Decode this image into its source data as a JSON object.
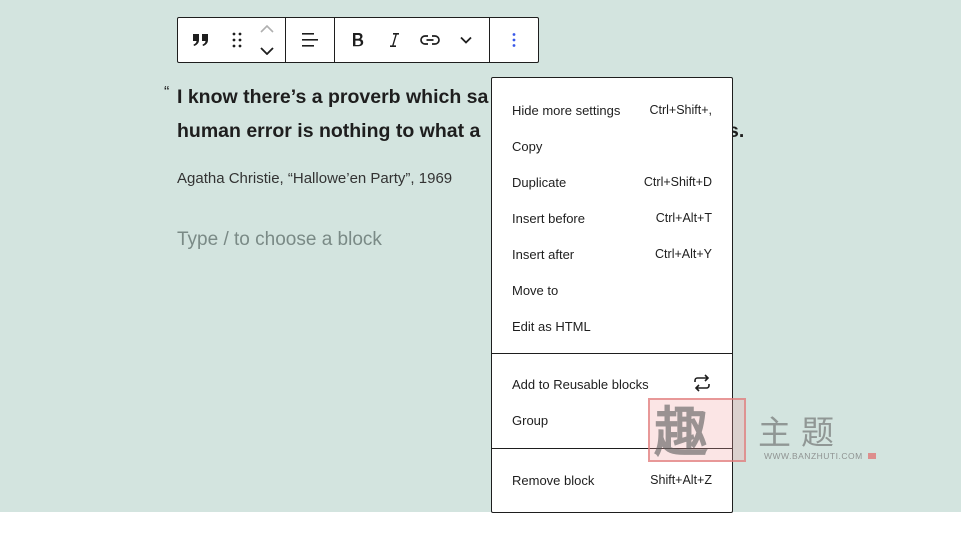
{
  "toolbar": {
    "items": [
      {
        "name": "quote-block-icon"
      },
      {
        "name": "drag-handle-icon"
      },
      {
        "name": "move-up-icon"
      },
      {
        "name": "move-down-icon"
      },
      {
        "name": "align-icon"
      },
      {
        "name": "bold-icon"
      },
      {
        "name": "italic-icon"
      },
      {
        "name": "link-icon"
      },
      {
        "name": "chevron-down-icon"
      },
      {
        "name": "more-options-icon"
      }
    ]
  },
  "quote": {
    "mark": "“",
    "line1": "I know there’s a proverb which sa",
    "line2": "human error is nothing to what a",
    "line2_tail": "s.",
    "citation": "Agatha Christie, “Hallowe’en Party”, 1969"
  },
  "placeholder": "Type / to choose a block",
  "menu": {
    "section1": [
      {
        "label": "Hide more settings",
        "shortcut": "Ctrl+Shift+,"
      },
      {
        "label": "Copy",
        "shortcut": ""
      },
      {
        "label": "Duplicate",
        "shortcut": "Ctrl+Shift+D"
      },
      {
        "label": "Insert before",
        "shortcut": "Ctrl+Alt+T"
      },
      {
        "label": "Insert after",
        "shortcut": "Ctrl+Alt+Y"
      },
      {
        "label": "Move to",
        "shortcut": ""
      },
      {
        "label": "Edit as HTML",
        "shortcut": ""
      }
    ],
    "section2": [
      {
        "label": "Add to Reusable blocks",
        "icon": "reusable-icon"
      },
      {
        "label": "Group"
      }
    ],
    "section3": [
      {
        "label": "Remove block",
        "shortcut": "Shift+Alt+Z"
      }
    ]
  },
  "watermark": {
    "glyph": "趣",
    "chinese": "主题",
    "url": "WWW.BANZHUTI.COM"
  }
}
